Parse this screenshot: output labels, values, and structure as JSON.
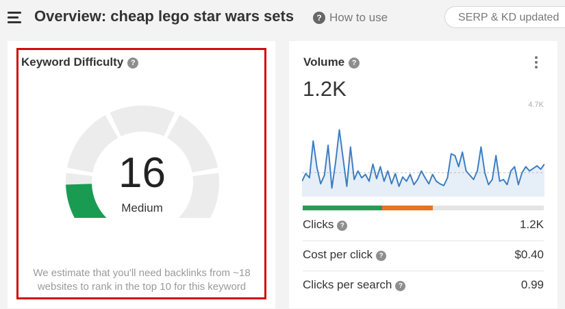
{
  "header": {
    "title": "Overview: cheap lego star wars sets",
    "help_label": "How to use",
    "serp_status": "SERP & KD updated"
  },
  "icons": {
    "menu": "hamburger-menu-icon",
    "help": "question-circle-icon",
    "more": "vertical-ellipsis-icon"
  },
  "keyword_difficulty": {
    "title": "Keyword Difficulty",
    "help_glyph": "?",
    "value": "16",
    "level": "Medium",
    "note": "We estimate that you'll need backlinks from ~18 websites to rank in the top 10 for this keyword",
    "score": 16,
    "max_score": 100,
    "fill_color": "#1a9b52",
    "track_color": "#ececec"
  },
  "volume": {
    "title": "Volume",
    "help_glyph": "?",
    "value": "1.2K",
    "chart_max_label": "4.7K",
    "line_color": "#3d7dc1",
    "fill_color": "#d6e4f3",
    "trend": [
      18,
      27,
      22,
      65,
      34,
      15,
      25,
      60,
      10,
      40,
      78,
      45,
      12,
      58,
      20,
      30,
      22,
      26,
      18,
      38,
      21,
      35,
      18,
      30,
      15,
      27,
      12,
      23,
      18,
      26,
      14,
      20,
      30,
      22,
      15,
      26,
      18,
      15,
      13,
      22,
      50,
      48,
      35,
      52,
      30,
      25,
      20,
      30,
      58,
      28,
      14,
      20,
      48,
      18,
      20,
      14,
      30,
      35,
      14,
      28,
      35,
      30,
      33,
      36,
      32,
      38
    ],
    "trend_reference": 28,
    "trend_max": 4700,
    "clicks_split": {
      "organic_share": 0.33,
      "paid_share": 0.21,
      "organic_color": "#2a9a56",
      "paid_color": "#e8741e",
      "rest_color": "#e4e4e4"
    },
    "metrics": [
      {
        "label": "Clicks",
        "value": "1.2K"
      },
      {
        "label": "Cost per click",
        "value": "$0.40"
      },
      {
        "label": "Clicks per search",
        "value": "0.99"
      }
    ]
  }
}
